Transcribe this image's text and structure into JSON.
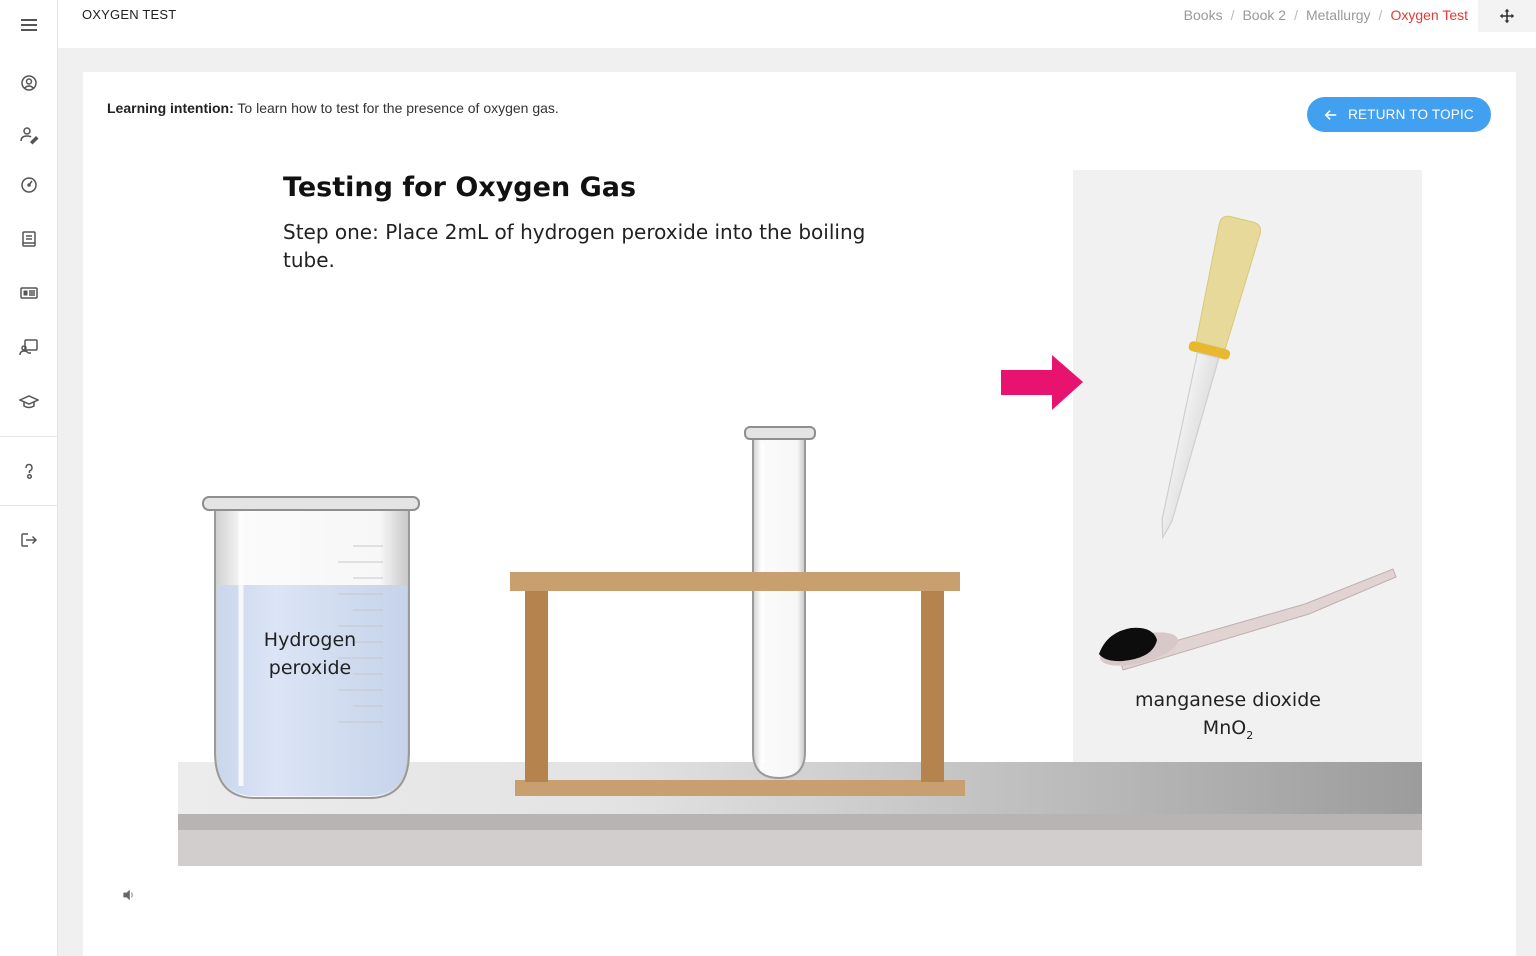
{
  "header": {
    "page_title": "OXYGEN TEST",
    "breadcrumb": [
      "Books",
      "Book 2",
      "Metallurgy",
      "Oxygen Test"
    ]
  },
  "sidebar": {
    "items": [
      {
        "icon": "user-circle-icon"
      },
      {
        "icon": "user-edit-icon"
      },
      {
        "icon": "dashboard-gauge-icon"
      },
      {
        "icon": "book-icon"
      },
      {
        "icon": "newspaper-icon"
      },
      {
        "icon": "teacher-board-icon"
      },
      {
        "icon": "graduation-cap-icon"
      },
      {
        "icon": "help-icon"
      },
      {
        "icon": "logout-icon"
      }
    ]
  },
  "content": {
    "learning_label": "Learning intention:",
    "learning_text": " To learn how to test for the presence of oxygen gas.",
    "return_button": "RETURN TO TOPIC"
  },
  "scene": {
    "title": "Testing for Oxygen Gas",
    "step": "Step one: Place 2mL of hydrogen peroxide into the boiling tube.",
    "beaker_label_line1": "Hydrogen",
    "beaker_label_line2": "peroxide",
    "mno2_label_line1": "manganese dioxide",
    "mno2_formula": "MnO",
    "mno2_subscript": "2",
    "arrow_color": "#e8136e",
    "sound_icon": "speaker-icon"
  },
  "colors": {
    "accent_blue": "#42a0f0",
    "breadcrumb_active": "#e53935",
    "wood": "#c8a070",
    "wood_dark": "#b5834d"
  }
}
